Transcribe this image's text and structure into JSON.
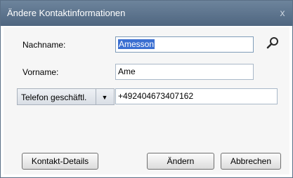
{
  "window": {
    "title": "Ändere Kontaktinformationen",
    "close_glyph": "x"
  },
  "form": {
    "nachname": {
      "label": "Nachname:",
      "value": "Amesson"
    },
    "vorname": {
      "label": "Vorname:",
      "value": "Ame"
    },
    "telefon": {
      "type_label": "Telefon geschäftl.",
      "value": "+492404673407162"
    }
  },
  "icons": {
    "search": "search-icon",
    "dropdown": "chevron-down-icon"
  },
  "buttons": {
    "details": "Kontakt-Details",
    "change": "Ändern",
    "cancel": "Abbrechen"
  },
  "colors": {
    "titlebar": "#5b728b",
    "selection": "#3b6fd1"
  }
}
